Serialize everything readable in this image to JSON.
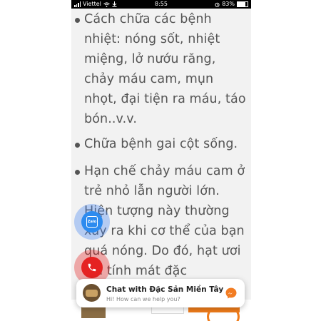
{
  "status_bar": {
    "carrier": "Viettel",
    "time": "8:55",
    "battery": "83%"
  },
  "content": {
    "items": [
      {
        "text": "Cách chữa các bệnh nhiệt: nóng sốt, nhiệt miệng, lở nướu răng, chảy máu cam, mụn nhọt, đại tiện ra máu, táo bón..v.v."
      },
      {
        "text": "Chữa bệnh gai cột sống."
      },
      {
        "text": "Hạn chế chảy máu cam ở trẻ nhỏ lẫn người lớn. Hiện tượng này thường xảy ra khi cơ thể của bạn quá nóng. Do đó, hạt ươi với tính mát đặc"
      }
    ]
  },
  "zalo_button": {
    "label": "Zalo",
    "icon": "zalo-icon"
  },
  "call_button": {
    "icon": "phone-icon"
  },
  "chat_widget": {
    "title": "Chat with Đặc Sản Miền Tây",
    "subtitle": "Hi! How can we help you?",
    "icon": "messenger-icon"
  },
  "colors": {
    "zalo_blue": "#2d8bef",
    "call_red": "#e52222",
    "accent_orange": "#f07c1a",
    "messenger_orange": "#f27c22"
  }
}
